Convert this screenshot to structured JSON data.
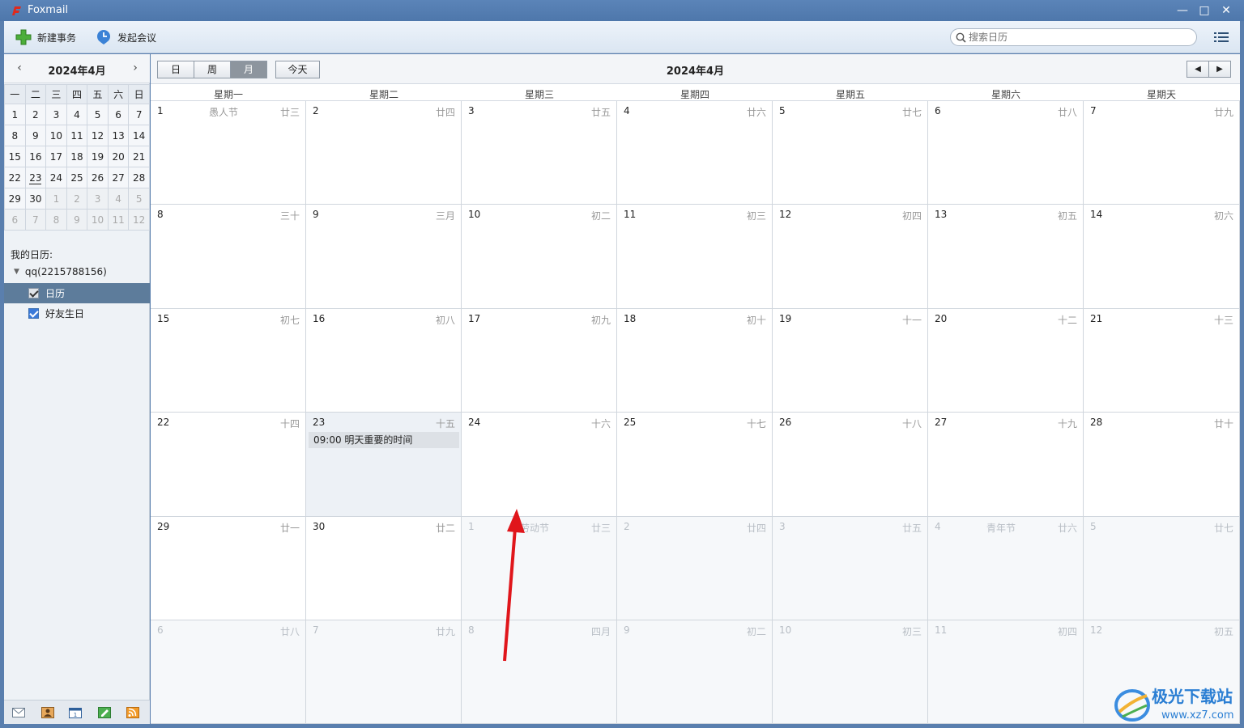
{
  "app": {
    "title": "Foxmail"
  },
  "toolbar": {
    "new_task": "新建事务",
    "start_meeting": "发起会议",
    "search_placeholder": "搜索日历"
  },
  "mini_calendar": {
    "month": "2024年4月",
    "weekdays": [
      "一",
      "二",
      "三",
      "四",
      "五",
      "六",
      "日"
    ],
    "weeks": [
      [
        "1",
        "2",
        "3",
        "4",
        "5",
        "6",
        "7"
      ],
      [
        "8",
        "9",
        "10",
        "11",
        "12",
        "13",
        "14"
      ],
      [
        "15",
        "16",
        "17",
        "18",
        "19",
        "20",
        "21"
      ],
      [
        "22",
        "23",
        "24",
        "25",
        "26",
        "27",
        "28"
      ],
      [
        "29",
        "30",
        "1",
        "2",
        "3",
        "4",
        "5"
      ],
      [
        "6",
        "7",
        "8",
        "9",
        "10",
        "11",
        "12"
      ]
    ]
  },
  "calendars": {
    "section_label": "我的日历:",
    "account": "qq(2215788156)",
    "items": [
      {
        "label": "日历"
      },
      {
        "label": "好友生日"
      }
    ]
  },
  "view": {
    "day": "日",
    "week": "周",
    "month": "月",
    "today": "今天",
    "title": "2024年4月"
  },
  "week_headers": [
    "星期一",
    "星期二",
    "星期三",
    "星期四",
    "星期五",
    "星期六",
    "星期天"
  ],
  "month_grid": [
    [
      {
        "d": "1",
        "h": "愚人节",
        "l": "廿三"
      },
      {
        "d": "2",
        "l": "廿四"
      },
      {
        "d": "3",
        "l": "廿五"
      },
      {
        "d": "4",
        "l": "廿六"
      },
      {
        "d": "5",
        "l": "廿七"
      },
      {
        "d": "6",
        "l": "廿八"
      },
      {
        "d": "7",
        "l": "廿九"
      }
    ],
    [
      {
        "d": "8",
        "l": "三十"
      },
      {
        "d": "9",
        "l": "三月"
      },
      {
        "d": "10",
        "l": "初二"
      },
      {
        "d": "11",
        "l": "初三"
      },
      {
        "d": "12",
        "l": "初四"
      },
      {
        "d": "13",
        "l": "初五"
      },
      {
        "d": "14",
        "l": "初六"
      }
    ],
    [
      {
        "d": "15",
        "l": "初七"
      },
      {
        "d": "16",
        "l": "初八"
      },
      {
        "d": "17",
        "l": "初九"
      },
      {
        "d": "18",
        "l": "初十"
      },
      {
        "d": "19",
        "l": "十一"
      },
      {
        "d": "20",
        "l": "十二"
      },
      {
        "d": "21",
        "l": "十三"
      }
    ],
    [
      {
        "d": "22",
        "l": "十四"
      },
      {
        "d": "23",
        "l": "十五",
        "today": true,
        "event": "09:00 明天重要的时间"
      },
      {
        "d": "24",
        "l": "十六"
      },
      {
        "d": "25",
        "l": "十七"
      },
      {
        "d": "26",
        "l": "十八"
      },
      {
        "d": "27",
        "l": "十九"
      },
      {
        "d": "28",
        "l": "廿十"
      }
    ],
    [
      {
        "d": "29",
        "l": "廿一"
      },
      {
        "d": "30",
        "l": "廿二"
      },
      {
        "d": "1",
        "h": "劳动节",
        "l": "廿三",
        "other": true
      },
      {
        "d": "2",
        "l": "廿四",
        "other": true
      },
      {
        "d": "3",
        "l": "廿五",
        "other": true
      },
      {
        "d": "4",
        "h": "青年节",
        "l": "廿六",
        "other": true
      },
      {
        "d": "5",
        "l": "廿七",
        "other": true
      }
    ],
    [
      {
        "d": "6",
        "l": "廿八",
        "other": true
      },
      {
        "d": "7",
        "l": "廿九",
        "other": true
      },
      {
        "d": "8",
        "l": "四月",
        "other": true
      },
      {
        "d": "9",
        "l": "初二",
        "other": true
      },
      {
        "d": "10",
        "l": "初三",
        "other": true
      },
      {
        "d": "11",
        "l": "初四",
        "other": true
      },
      {
        "d": "12",
        "l": "初五",
        "other": true
      }
    ]
  ],
  "watermark": {
    "brand": "极光下载站",
    "url": "www.xz7.com"
  },
  "colors": {
    "accent": "#3b7ad9",
    "selected_row": "#5d7c9b",
    "arrow": "#e0161b"
  }
}
